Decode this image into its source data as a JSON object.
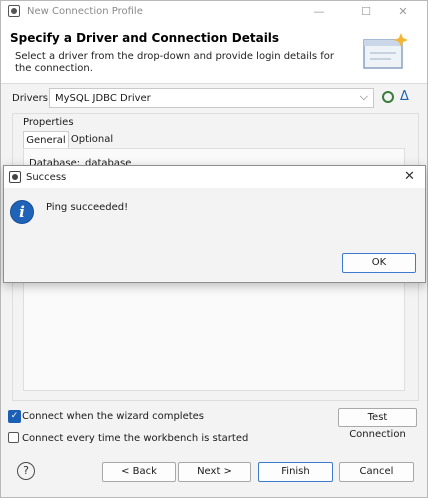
{
  "window": {
    "title": "New Connection Profile",
    "controls": {
      "minimize": "—",
      "maximize": "☐",
      "close": "✕"
    }
  },
  "header": {
    "title": "Specify a Driver and Connection Details",
    "description": "Select a driver from the drop-down and provide login details for the connection."
  },
  "drivers": {
    "label": "Drivers:",
    "value": "MySQL JDBC Driver",
    "chevron": "⌵",
    "edit_icon_glyph": "Δ"
  },
  "properties": {
    "label": "Properties",
    "tabs": [
      {
        "label": "General",
        "selected": true
      },
      {
        "label": "Optional",
        "selected": false
      }
    ],
    "database_label": "Database:",
    "database_value": "database"
  },
  "options": {
    "connect_when_wizard_completes": {
      "label": "Connect when the wizard completes",
      "checked": true
    },
    "connect_every_time": {
      "label": "Connect every time the workbench is started",
      "checked": false
    }
  },
  "buttons": {
    "test_connection": "Test Connection",
    "help_glyph": "?",
    "back": "< Back",
    "next": "Next >",
    "finish": "Finish",
    "cancel": "Cancel"
  },
  "success_dialog": {
    "title": "Success",
    "message": "Ping succeeded!",
    "ok": "OK",
    "close": "✕",
    "info_glyph": "i"
  },
  "colors": {
    "accent": "#1b5fb5",
    "default_button_border": "#3d7bd0"
  }
}
